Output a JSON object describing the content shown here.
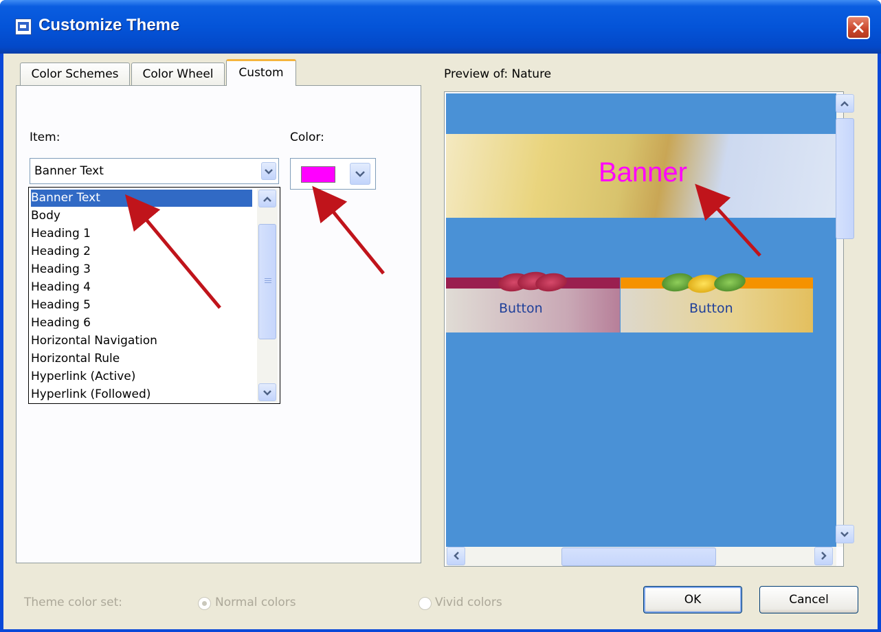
{
  "window": {
    "title": "Customize Theme"
  },
  "tabs": [
    {
      "label": "Color Schemes",
      "active": false
    },
    {
      "label": "Color Wheel",
      "active": false
    },
    {
      "label": "Custom",
      "active": true
    }
  ],
  "custom_tab": {
    "item_label": "Item:",
    "item_selected": "Banner Text",
    "color_label": "Color:",
    "color_value": "#ff00ff",
    "item_options": [
      "Banner Text",
      "Body",
      "Heading 1",
      "Heading 2",
      "Heading 3",
      "Heading 4",
      "Heading 5",
      "Heading 6",
      "Horizontal Navigation",
      "Horizontal Rule",
      "Hyperlink (Active)",
      "Hyperlink (Followed)"
    ]
  },
  "preview": {
    "label": "Preview of: Nature",
    "banner_text": "Banner",
    "buttons": [
      "Button",
      "Button"
    ]
  },
  "footer": {
    "color_set_label": "Theme color set:",
    "normal_colors": "Normal colors",
    "vivid_colors": "Vivid colors",
    "normal_selected": true,
    "ok": "OK",
    "cancel": "Cancel"
  },
  "colors": {
    "titlebar": "#0454d8",
    "selection": "#316ac5",
    "preview_background": "#4a91d6",
    "annotation_arrow": "#c0141b"
  }
}
